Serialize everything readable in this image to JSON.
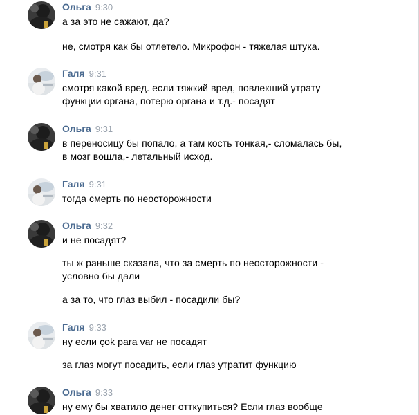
{
  "authors": {
    "olga": "Ольга",
    "galya": "Галя"
  },
  "messages": [
    {
      "author": "Ольга",
      "time": "9:30",
      "avatar": "olga-avatar",
      "lines": [
        "а за это не сажают, да?",
        "не, смотря как бы отлетело. Микрофон - тяжелая штука."
      ]
    },
    {
      "author": "Галя",
      "time": "9:31",
      "avatar": "galya-avatar",
      "lines": [
        "смотря какой вред. если тяжкий вред, повлекший утрату",
        "функции органа, потерю органа и т.д.- посадят"
      ]
    },
    {
      "author": "Ольга",
      "time": "9:31",
      "avatar": "olga-avatar",
      "lines": [
        "в переносицу бы попало, а там кость тонкая,- сломалась бы,",
        "в мозг вошла,- летальный исход."
      ]
    },
    {
      "author": "Галя",
      "time": "9:31",
      "avatar": "galya-avatar",
      "lines": [
        "тогда смерть по неосторожности"
      ]
    },
    {
      "author": "Ольга",
      "time": "9:32",
      "avatar": "olga-avatar",
      "lines": [
        "и не посадят?",
        "ты ж раньше сказала, что за смерть по неосторожности -",
        "условно бы дали",
        "а за то, что глаз выбил - посадили бы?"
      ]
    },
    {
      "author": "Галя",
      "time": "9:33",
      "avatar": "galya-avatar",
      "lines": [
        "ну если çok para var не посадят",
        "за глаз могут посадить, если глаз утратит функцию"
      ]
    },
    {
      "author": "Ольга",
      "time": "9:33",
      "avatar": "olga-avatar",
      "lines": [
        "ну ему бы хватило денег отткупиться? Если глаз вообще"
      ]
    }
  ]
}
